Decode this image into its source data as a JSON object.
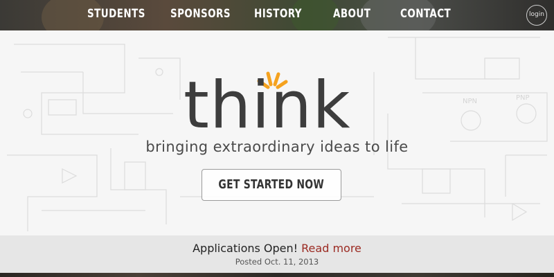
{
  "nav": {
    "items": [
      {
        "label": "STUDENTS"
      },
      {
        "label": "SPONSORS"
      },
      {
        "label": "HISTORY"
      },
      {
        "label": "ABOUT"
      },
      {
        "label": "CONTACT"
      }
    ],
    "login_label": "login"
  },
  "hero": {
    "logo_text": "think",
    "tagline": "bringing extraordinary ideas to life",
    "cta_label": "GET STARTED NOW",
    "schematic_labels": [
      "NPN",
      "PNP"
    ]
  },
  "announcement": {
    "text": "Applications Open!",
    "link_label": "Read more",
    "posted": "Posted Oct. 11, 2013"
  },
  "colors": {
    "accent_orange": "#f5a21f",
    "link_red": "#9b2a22",
    "logo_text": "#3d3d3d"
  },
  "icons": [
    "spark-rays-icon"
  ]
}
